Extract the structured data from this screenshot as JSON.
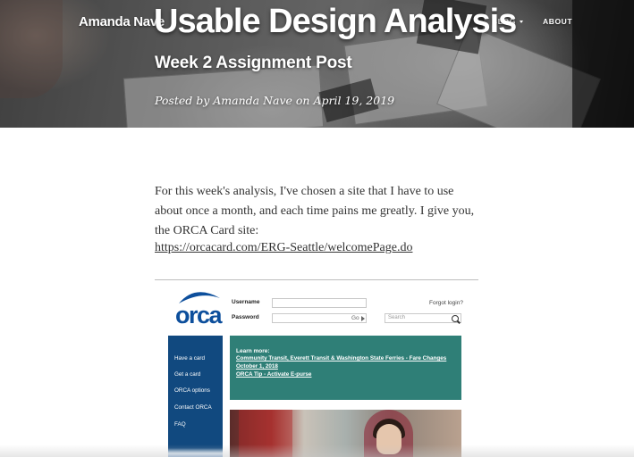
{
  "header": {
    "brand": "Amanda Nave",
    "nav": [
      {
        "label": "BLOG",
        "has_dropdown": true
      },
      {
        "label": "ABOUT",
        "has_dropdown": false
      }
    ],
    "title": "Usable Design Analysis",
    "subtitle": "Week 2 Assignment Post",
    "meta": "Posted by Amanda Nave on April 19, 2019"
  },
  "article": {
    "intro": "For this week's analysis, I've chosen a site that I have to use about once a month, and each time pains me greatly. I give you, the ORCA Card site:",
    "link_text": "https://orcacard.com/ERG-Seattle/welcomePage.do"
  },
  "orca_screenshot": {
    "logo_text": "orca",
    "username_label": "Username",
    "password_label": "Password",
    "go_label": "Go",
    "forgot_label": "Forgot login?",
    "search_placeholder": "Search",
    "side_nav": [
      "Have a card",
      "Get a card",
      "ORCA options",
      "Contact ORCA",
      "FAQ"
    ],
    "learn_title": "Learn more:",
    "learn_links": [
      "Community Transit, Everett Transit & Washington State Ferries - Fare Changes October 1, 2018",
      "ORCA Tip - Activate E-purse"
    ],
    "colors": {
      "nav_blue": "#11497f",
      "teal": "#2f7f77",
      "logo_blue": "#0d4f9c"
    }
  },
  "icons": [
    "chevron-down-icon",
    "search-icon",
    "play-arrow-icon"
  ]
}
